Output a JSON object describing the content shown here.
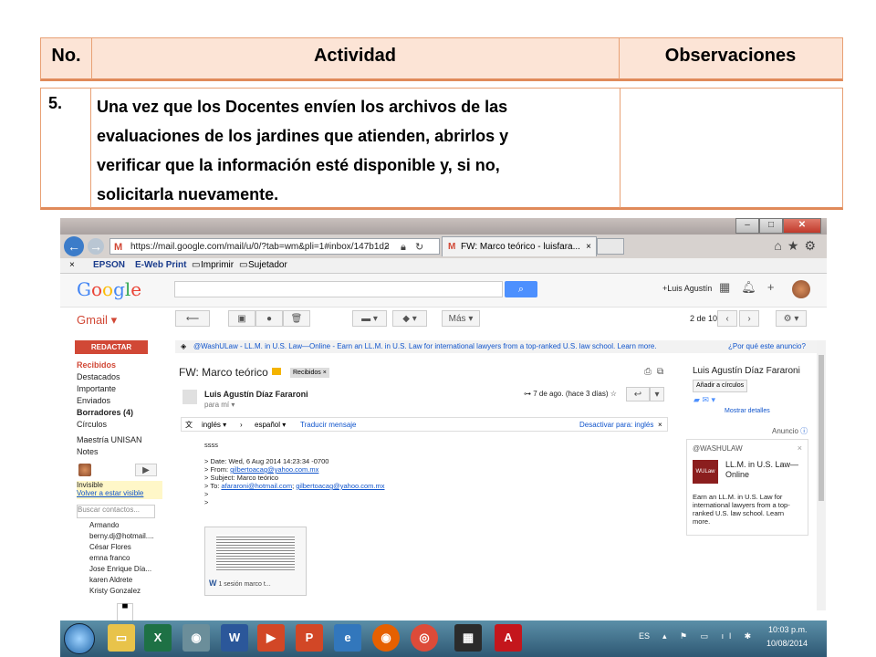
{
  "doc_table": {
    "header": {
      "no": "No.",
      "actividad": "Actividad",
      "observaciones": "Observaciones"
    },
    "row": {
      "no": "5.",
      "actividad_lines": [
        "Una vez que los Docentes envíen los archivos de las",
        "evaluaciones de los jardines que atienden, abrirlos y",
        "verificar que la información esté disponible y, si no,",
        "solicitarla nuevamente."
      ],
      "observaciones": ""
    },
    "border_color": "#e8a074",
    "header_bg": "#fce4d6"
  },
  "browser": {
    "url": "https://mail.google.com/mail/u/0/?tab=wm&pli=1#inbox/147b1d2",
    "tab_title": "FW: Marco teórico - luisfara...",
    "toolbar": {
      "epson": "EPSON",
      "ewebprint": "E-Web Print",
      "imprimir": "Imprimir",
      "sujetador": "Sujetador"
    }
  },
  "gmail": {
    "logo": "Google",
    "user": "+Luis Agustín",
    "label": "Gmail",
    "more_button": "Más",
    "page_count": "2 de 10",
    "compose": "REDACTAR",
    "nav": [
      "Recibidos",
      "Destacados",
      "Importante",
      "Enviados",
      "Borradores (4)",
      "Círculos",
      "Maestría UNISAN",
      "Notes"
    ],
    "chat_status": "Invisible",
    "chat_visible_link": "Volver a estar visible",
    "chat_search_placeholder": "Buscar contactos...",
    "contacts": [
      "Armando",
      "berny.dj@hotmail....",
      "César Flores",
      "emna franco",
      "Jose Enrique Día...",
      "karen Aldrete",
      "Kristy Gonzalez"
    ],
    "ad_bar": "@WashULaw - LL.M. in U.S. Law—Online - Earn an LL.M. in U.S. Law for international lawyers from a top-ranked U.S. law school. Learn more.",
    "ad_bar_why": "¿Por qué este anuncio?",
    "subject": "FW: Marco teórico",
    "subject_label": "Recibidos",
    "sender": "Luis Agustín Díaz Fararoni",
    "sender_sub": "para mí",
    "date": "7 de ago. (hace 3 días)",
    "translate": {
      "from": "inglés",
      "to": "español",
      "action": "Traducir mensaje",
      "disable": "Desactivar para: inglés"
    },
    "body": {
      "ssss": "ssss",
      "date_line": "> Date: Wed, 6 Aug 2014 14:23:34 -0700",
      "from_prefix": "> From: ",
      "from_link": "gilbertoacag@yahoo.com.mx",
      "subject_line": "> Subject: Marco teórico",
      "to_prefix": "> To: ",
      "to_link1": "afararoni@hotmail.com",
      "to_link2": "gilbertoacag@yahoo.com.mx",
      "gt": ">"
    },
    "attachment": "1 sesión marco t...",
    "right_panel": {
      "name": "Luis Agustín Díaz Fararoni",
      "add_circles": "Añadir a círculos",
      "details": "Mostrar detalles",
      "anuncio": "Anuncio",
      "ad_head": "@WASHULAW",
      "ad_logo": "WULaw",
      "ad_title": "LL.M. in U.S. Law—Online",
      "ad_body": "Earn an LL.M. in U.S. Law for international lawyers from a top-ranked U.S. law school. Learn more."
    }
  },
  "taskbar": {
    "lang": "ES",
    "time": "10:03 p.m.",
    "date": "10/08/2014"
  }
}
